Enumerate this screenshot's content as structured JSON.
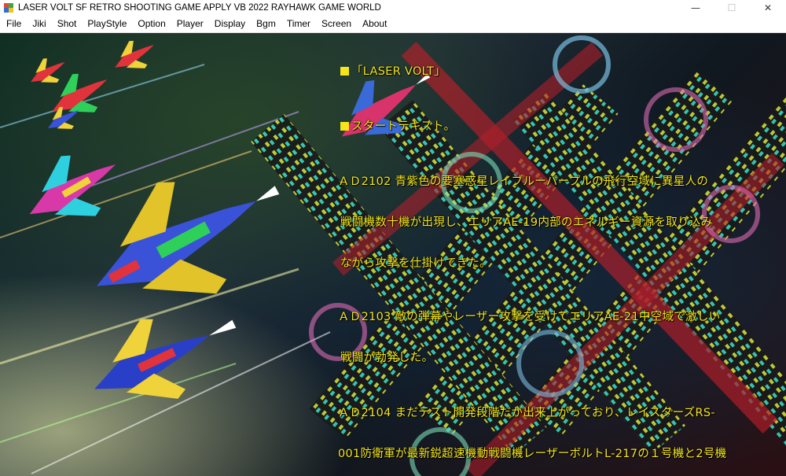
{
  "window": {
    "title": "LASER VOLT SF RETRO SHOOTING GAME APPLY VB 2022 RAYHAWK GAME WORLD",
    "controls": {
      "minimize": "—",
      "maximize": "☐",
      "close": "✕"
    }
  },
  "menu": [
    "File",
    "Jiki",
    "Shot",
    "PlayStyle",
    "Option",
    "Player",
    "Display",
    "Bgm",
    "Timer",
    "Screen",
    "About"
  ],
  "story": {
    "heading": "「LASER VOLT」",
    "start_label": "スタートテキスト。",
    "lines": [
      "ＡＤ2102  青紫色の要塞惑星レイブルーパープルの飛行空域に異星人の",
      "戦闘機数十機が出現し、エリアAE-19内部のエネルギー資源を取り込み",
      "ながら攻撃を仕掛けてきた。",
      "ＡＤ2103  敵の弾幕やレーザー攻撃を受けてエリアAE-21中空域で激しい",
      "戦闘が勃発した。",
      "ＡＤ2104  まだテスト開発段階だが出来上がっており、レイスターズRS-",
      "001防衛軍が最新鋭超速機動戦闘機レーザーボルトL-217の１号機と2号機"
    ]
  },
  "colors": {
    "story_text": "#f4e61a",
    "menu_bg": "#ffffff"
  },
  "icons": [
    "app-icon",
    "minimize-icon",
    "maximize-icon",
    "close-icon"
  ]
}
